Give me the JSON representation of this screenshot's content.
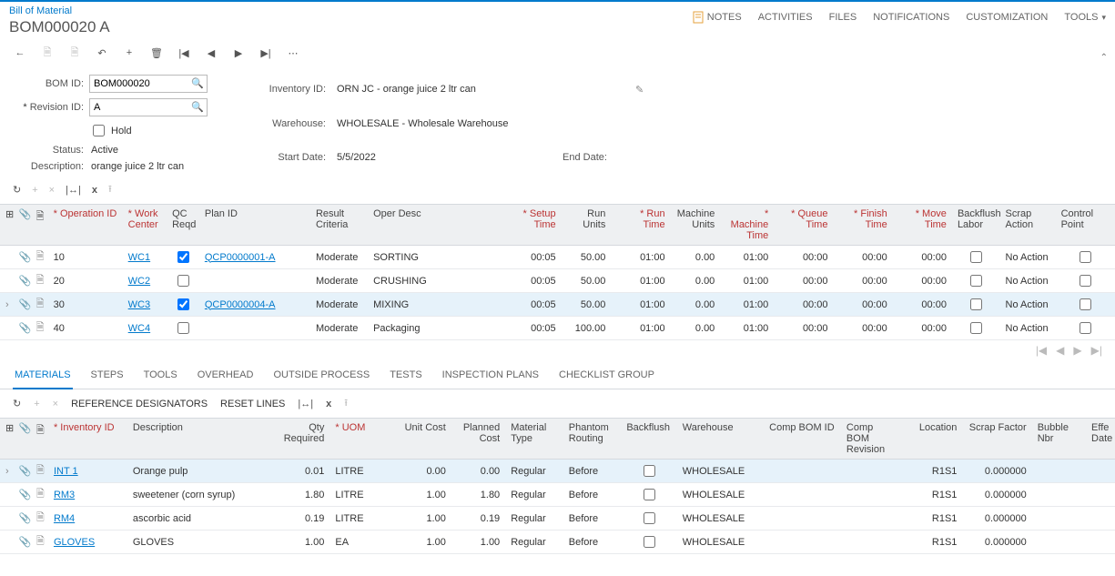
{
  "header": {
    "breadcrumb": "Bill of Material",
    "title": "BOM000020 A",
    "nav": {
      "notes": "NOTES",
      "activities": "ACTIVITIES",
      "files": "FILES",
      "notifications": "NOTIFICATIONS",
      "customization": "CUSTOMIZATION",
      "tools": "TOOLS"
    }
  },
  "form": {
    "labels": {
      "bom_id": "BOM ID:",
      "revision_id": "Revision ID:",
      "hold": "Hold",
      "status": "Status:",
      "description": "Description:",
      "inventory_id": "Inventory ID:",
      "warehouse": "Warehouse:",
      "start_date": "Start Date:",
      "end_date": "End Date:"
    },
    "bom_id": "BOM000020",
    "revision_id": "A",
    "status": "Active",
    "description": "orange juice 2 ltr can",
    "inventory_id": "ORN JC - orange juice 2 ltr can",
    "warehouse": "WHOLESALE - Wholesale Warehouse",
    "start_date": "5/5/2022",
    "end_date": ""
  },
  "ops_grid": {
    "headers": {
      "operation_id": "Operation ID",
      "work_center": "Work Center",
      "qc_reqd": "QC Reqd",
      "plan_id": "Plan ID",
      "result_criteria": "Result Criteria",
      "oper_desc": "Oper Desc",
      "setup_time": "Setup Time",
      "run_units": "Run Units",
      "run_time": "Run Time",
      "machine_units": "Machine Units",
      "machine_time": "Machine Time",
      "queue_time": "Queue Time",
      "finish_time": "Finish Time",
      "move_time": "Move Time",
      "backflush_labor": "Backflush Labor",
      "scrap_action": "Scrap Action",
      "control_point": "Control Point"
    },
    "rows": [
      {
        "op": "10",
        "wc": "WC1",
        "qc": true,
        "plan": "QCP0000001-A",
        "rc": "Moderate",
        "desc": "SORTING",
        "setup": "00:05",
        "runu": "50.00",
        "runt": "01:00",
        "mu": "0.00",
        "mt": "01:00",
        "qt": "00:00",
        "ft": "00:00",
        "mvt": "00:00",
        "bfl": false,
        "scrap": "No Action",
        "cp": false,
        "selected": false
      },
      {
        "op": "20",
        "wc": "WC2",
        "qc": false,
        "plan": "",
        "rc": "Moderate",
        "desc": "CRUSHING",
        "setup": "00:05",
        "runu": "50.00",
        "runt": "01:00",
        "mu": "0.00",
        "mt": "01:00",
        "qt": "00:00",
        "ft": "00:00",
        "mvt": "00:00",
        "bfl": false,
        "scrap": "No Action",
        "cp": false,
        "selected": false
      },
      {
        "op": "30",
        "wc": "WC3",
        "qc": true,
        "plan": "QCP0000004-A",
        "rc": "Moderate",
        "desc": "MIXING",
        "setup": "00:05",
        "runu": "50.00",
        "runt": "01:00",
        "mu": "0.00",
        "mt": "01:00",
        "qt": "00:00",
        "ft": "00:00",
        "mvt": "00:00",
        "bfl": false,
        "scrap": "No Action",
        "cp": false,
        "selected": true
      },
      {
        "op": "40",
        "wc": "WC4",
        "qc": false,
        "plan": "",
        "rc": "Moderate",
        "desc": "Packaging",
        "setup": "00:05",
        "runu": "100.00",
        "runt": "01:00",
        "mu": "0.00",
        "mt": "01:00",
        "qt": "00:00",
        "ft": "00:00",
        "mvt": "00:00",
        "bfl": false,
        "scrap": "No Action",
        "cp": false,
        "selected": false
      }
    ]
  },
  "tabs": {
    "materials": "MATERIALS",
    "steps": "STEPS",
    "tools": "TOOLS",
    "overhead": "OVERHEAD",
    "outside": "OUTSIDE PROCESS",
    "tests": "TESTS",
    "inspection": "INSPECTION PLANS",
    "checklist": "CHECKLIST GROUP"
  },
  "sub_buttons": {
    "ref": "REFERENCE DESIGNATORS",
    "reset": "RESET LINES"
  },
  "mat_grid": {
    "headers": {
      "inventory_id": "Inventory ID",
      "description": "Description",
      "qty": "Qty Required",
      "uom": "UOM",
      "unit_cost": "Unit Cost",
      "planned_cost": "Planned Cost",
      "material_type": "Material Type",
      "phantom": "Phantom Routing",
      "backflush": "Backflush",
      "warehouse": "Warehouse",
      "comp_bom": "Comp BOM ID",
      "comp_rev": "Comp BOM Revision",
      "location": "Location",
      "scrap": "Scrap Factor",
      "bubble": "Bubble Nbr",
      "eff": "Effe Date"
    },
    "rows": [
      {
        "inv": "INT 1",
        "desc": "Orange pulp",
        "qty": "0.01",
        "uom": "LITRE",
        "uc": "0.00",
        "pc": "0.00",
        "mt": "Regular",
        "ph": "Before",
        "bf": false,
        "wh": "WHOLESALE",
        "cb": "",
        "cr": "",
        "loc": "R1S1",
        "sf": "0.000000",
        "bn": "",
        "selected": true
      },
      {
        "inv": "RM3",
        "desc": "sweetener (corn syrup)",
        "qty": "1.80",
        "uom": "LITRE",
        "uc": "1.00",
        "pc": "1.80",
        "mt": "Regular",
        "ph": "Before",
        "bf": false,
        "wh": "WHOLESALE",
        "cb": "",
        "cr": "",
        "loc": "R1S1",
        "sf": "0.000000",
        "bn": "",
        "selected": false
      },
      {
        "inv": "RM4",
        "desc": "ascorbic acid",
        "qty": "0.19",
        "uom": "LITRE",
        "uc": "1.00",
        "pc": "0.19",
        "mt": "Regular",
        "ph": "Before",
        "bf": false,
        "wh": "WHOLESALE",
        "cb": "",
        "cr": "",
        "loc": "R1S1",
        "sf": "0.000000",
        "bn": "",
        "selected": false
      },
      {
        "inv": "GLOVES",
        "desc": "GLOVES",
        "qty": "1.00",
        "uom": "EA",
        "uc": "1.00",
        "pc": "1.00",
        "mt": "Regular",
        "ph": "Before",
        "bf": false,
        "wh": "WHOLESALE",
        "cb": "",
        "cr": "",
        "loc": "R1S1",
        "sf": "0.000000",
        "bn": "",
        "selected": false
      }
    ]
  }
}
